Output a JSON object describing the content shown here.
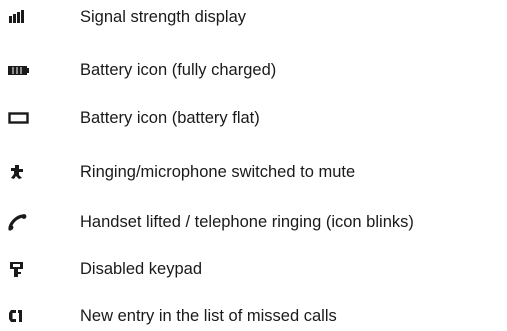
{
  "legend": {
    "items": [
      {
        "icon": "signal-strength-icon",
        "label": "Signal strength display"
      },
      {
        "icon": "battery-full-icon",
        "label": "Battery icon (fully charged)"
      },
      {
        "icon": "battery-flat-icon",
        "label": "Battery icon (battery flat)"
      },
      {
        "icon": "mute-icon",
        "label": "Ringing/microphone switched to mute"
      },
      {
        "icon": "handset-icon",
        "label": "Handset lifted / telephone ringing (icon blinks)"
      },
      {
        "icon": "keypad-lock-icon",
        "label": "Disabled keypad"
      },
      {
        "icon": "missed-calls-icon",
        "label": "New entry in the list of missed  calls"
      }
    ]
  },
  "colors": {
    "text": "#1a1a1a",
    "icon": "#1a1a1a"
  }
}
